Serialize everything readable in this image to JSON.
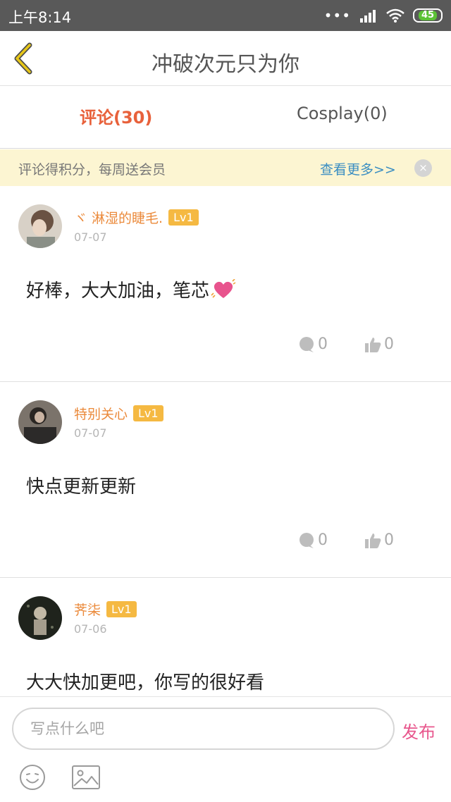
{
  "status_bar": {
    "time": "上午8:14",
    "dots": "•••",
    "battery": "45"
  },
  "header": {
    "title": "冲破次元只为你",
    "back_icon": "chevron-left-icon",
    "accent_color": "#e6c619"
  },
  "tabs": [
    {
      "label": "评论(30)",
      "active": true
    },
    {
      "label": "Cosplay(0)",
      "active": false
    }
  ],
  "banner": {
    "text": "评论得积分，每周送会员",
    "more": "查看更多>>",
    "close": "×"
  },
  "comments": [
    {
      "username": "ヾ 淋湿的睫毛.",
      "level": "Lv1",
      "date": "07-07",
      "content": "好棒，大大加油，笔芯",
      "emoji": "heart-icon",
      "reply_count": "0",
      "like_count": "0"
    },
    {
      "username": "特别关心",
      "level": "Lv1",
      "date": "07-07",
      "content": "快点更新更新",
      "reply_count": "0",
      "like_count": "0"
    },
    {
      "username": "荠柒",
      "level": "Lv1",
      "date": "07-06",
      "content": "大大快加更吧，你写的很好看"
    }
  ],
  "composer": {
    "placeholder": "写点什么吧",
    "publish": "发布",
    "emoji_icon": "smiley-icon",
    "image_icon": "image-icon"
  },
  "colors": {
    "active_tab": "#e8613b",
    "username": "#eb8a3b",
    "level_badge": "#f5b942",
    "link": "#3b8ec2",
    "publish": "#e8578d"
  }
}
